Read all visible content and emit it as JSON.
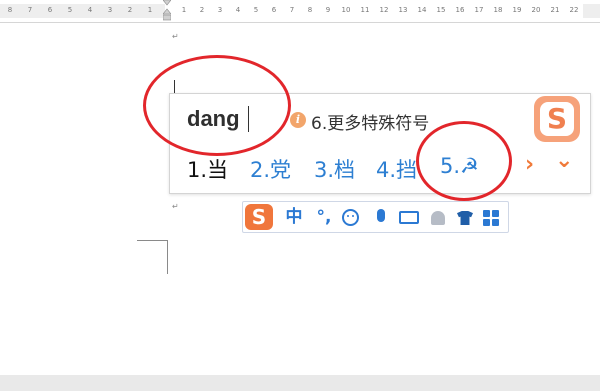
{
  "ruler": {
    "left_numbers": [
      "8",
      "7",
      "6",
      "5",
      "4",
      "3",
      "2",
      "1"
    ],
    "right_numbers": [
      "1",
      "2",
      "3",
      "4",
      "5",
      "6",
      "7",
      "8",
      "9",
      "10",
      "11",
      "12",
      "13",
      "14",
      "15",
      "16",
      "17",
      "18",
      "19",
      "20",
      "21",
      "22"
    ]
  },
  "document": {
    "paragraph_mark": "↵"
  },
  "ime": {
    "composition": "dang",
    "info_icon_glyph": "i",
    "hint": "6.更多特殊符号",
    "logo_glyph": "S",
    "candidates": [
      {
        "label": "1.当"
      },
      {
        "label": "2.党"
      },
      {
        "label": "3.档"
      },
      {
        "label": "4.挡"
      },
      {
        "label": "5.☭"
      }
    ],
    "next_arrow": "›",
    "expand_arrow": "⌄"
  },
  "toolbar": {
    "logo_glyph": "S",
    "lang": "中",
    "punct": "°,",
    "icons": [
      "smile-icon",
      "microphone-icon",
      "keyboard-icon",
      "user-icon",
      "skin-icon",
      "toolbox-icon"
    ]
  },
  "colors": {
    "annotation": "#e2262b",
    "candidate_blue": "#2d7fd2",
    "sogou_orange": "#f0763c"
  }
}
